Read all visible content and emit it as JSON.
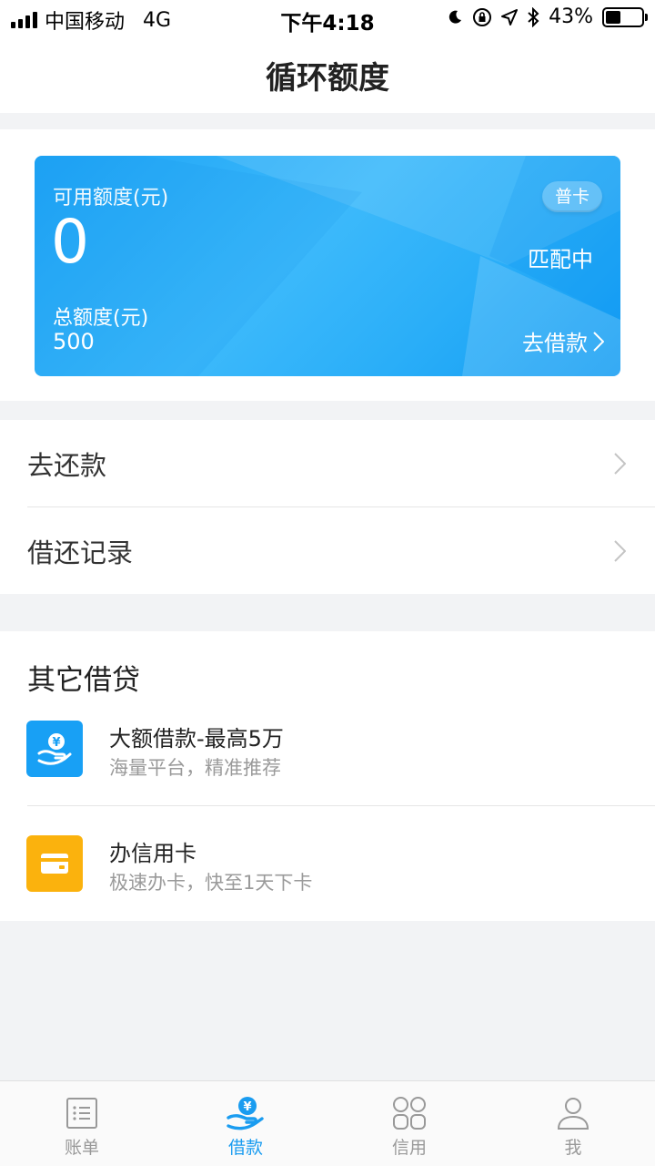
{
  "status_bar": {
    "carrier": "中国移动",
    "network": "4G",
    "time": "下午4:18",
    "battery": "43%",
    "battery_level": 0.43
  },
  "nav": {
    "title": "循环额度"
  },
  "card": {
    "available_label": "可用额度(元)",
    "available_value": "0",
    "badge": "普卡",
    "status": "匹配中",
    "total_label": "总额度(元)",
    "total_value": "500",
    "borrow_link": "去借款",
    "colors": {
      "start": "#1ea4f5",
      "end": "#129cf3"
    }
  },
  "list": {
    "repay": "去还款",
    "records": "借还记录"
  },
  "other": {
    "title": "其它借贷",
    "items": [
      {
        "title": "大额借款-最高5万",
        "subtitle": "海量平台，精准推荐",
        "icon": "money-hand-icon",
        "color": "#18a0f5"
      },
      {
        "title": "办信用卡",
        "subtitle": "极速办卡，快至1天下卡",
        "icon": "wallet-card-icon",
        "color": "#fbb20d"
      }
    ]
  },
  "tabs": [
    {
      "label": "账单",
      "icon": "bill-list-icon",
      "active": false
    },
    {
      "label": "借款",
      "icon": "money-hand-icon",
      "active": true
    },
    {
      "label": "信用",
      "icon": "grid-circles-icon",
      "active": false
    },
    {
      "label": "我",
      "icon": "person-icon",
      "active": false
    }
  ],
  "colors": {
    "accent": "#1a9cf0",
    "background": "#f2f3f5"
  }
}
